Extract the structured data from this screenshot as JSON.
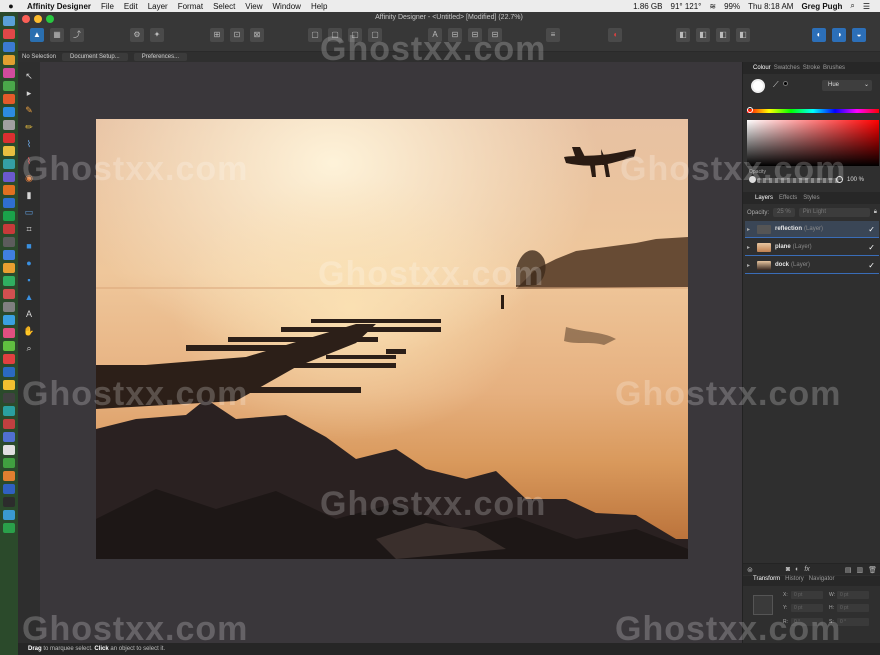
{
  "menubar": {
    "app": "Affinity Designer",
    "items": [
      "File",
      "Edit",
      "Layer",
      "Format",
      "Select",
      "View",
      "Window",
      "Help"
    ],
    "status": {
      "storage": "1.86 GB",
      "temp": "91° 121°",
      "battery": "99%",
      "clock": "Thu 8:18 AM",
      "user": "Greg Pugh"
    }
  },
  "window": {
    "title": "Affinity Designer - <Untitled> [Modified] (22.7%)"
  },
  "context_toolbar": {
    "selection": "No Selection",
    "document_setup": "Document Setup...",
    "preferences": "Preferences..."
  },
  "color_panel": {
    "tabs": [
      "Colour",
      "Swatches",
      "Stroke",
      "Brushes"
    ],
    "mode": "Hue",
    "opacity_label": "Opacity",
    "opacity_value": "100 %"
  },
  "layers_panel": {
    "tabs": [
      "Layers",
      "Effects",
      "Styles"
    ],
    "opacity_label": "Opacity:",
    "opacity_value": "25 %",
    "blend_mode": "Pin Light",
    "layers": [
      {
        "name": "reflection",
        "kind": "(Layer)",
        "selected": true
      },
      {
        "name": "plane",
        "kind": "(Layer)",
        "selected": false
      },
      {
        "name": "dock",
        "kind": "(Layer)",
        "selected": false
      }
    ]
  },
  "transform_panel": {
    "tabs": [
      "Transform",
      "History",
      "Navigator"
    ],
    "fields": [
      {
        "label": "X:",
        "value": "0 pt"
      },
      {
        "label": "Y:",
        "value": "0 pt"
      },
      {
        "label": "W:",
        "value": "0 pt"
      },
      {
        "label": "H:",
        "value": "0 pt"
      },
      {
        "label": "R:",
        "value": "0 °"
      },
      {
        "label": "S:",
        "value": "0 °"
      }
    ]
  },
  "statusbar": {
    "a": "Drag",
    "b": " to marquee select. ",
    "c": "Click",
    "d": " an object to select it."
  },
  "watermark": "Ghostxx.com",
  "colors": {
    "accent": "#2a6fb0",
    "canvas": "#3a373b",
    "selected_layer": "#3a4656"
  }
}
